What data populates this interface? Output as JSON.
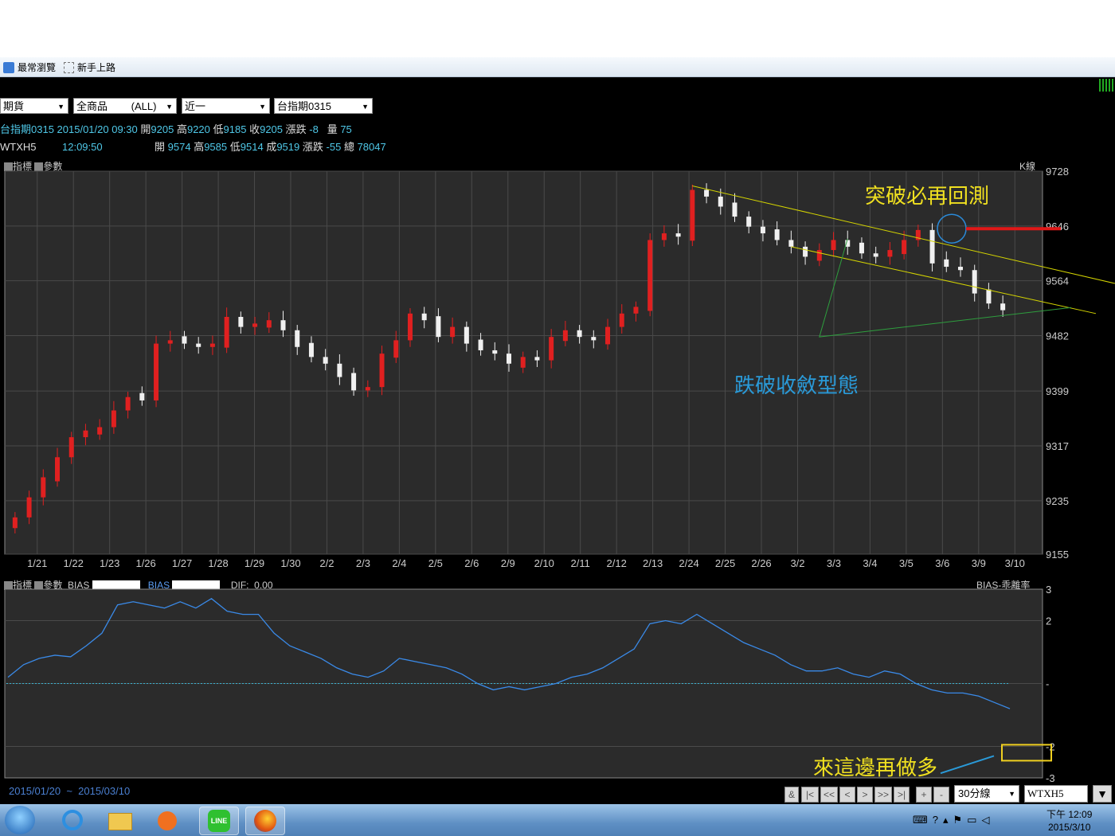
{
  "favorites_bar": {
    "items": [
      {
        "label": "最常瀏覽",
        "icon": "bookmark-icon"
      },
      {
        "label": "新手上路",
        "icon": "page-icon"
      }
    ]
  },
  "toolbar": {
    "market_select": "期貨",
    "product_select": "全商品 　　(ALL)",
    "month_select": "近一",
    "contract_select": "台指期0315"
  },
  "quote_line_1": {
    "name": "台指期0315",
    "datetime": "2015/01/20 09:30",
    "open_label": "開",
    "open": "9205",
    "high_label": "高",
    "high": "9220",
    "low_label": "低",
    "low": "9185",
    "close_label": "收",
    "close": "9205",
    "change_label": "漲跌",
    "change": "-8",
    "volume_label": "量",
    "volume": "75"
  },
  "quote_line_2": {
    "name": "WTXH5",
    "time": "12:09:50",
    "open_label": "開",
    "open": "9574",
    "high_label": "高",
    "high": "9585",
    "low_label": "低",
    "low": "9514",
    "last_label": "成",
    "last": "9519",
    "change_label": "漲跌",
    "change": "-55",
    "total_label": "總",
    "total": "78047"
  },
  "main_panel": {
    "indicator_btn": "指標",
    "param_btn": "參數",
    "chart_type": "K線",
    "annotation_breakout": "突破必再回測",
    "annotation_breakdown": "跌破收斂型態"
  },
  "sub_panel": {
    "indicator_btn": "指標",
    "param_btn": "參數",
    "bias_label_1": "BIAS",
    "bias_label_2": "BIAS",
    "dif_label": "DIF:",
    "dif_value": "0.00",
    "title": "BIAS-乖離率",
    "annotation_buy": "來這邊再做多"
  },
  "footer": {
    "date_from": "2015/01/20",
    "tilde": "~",
    "date_to": "2015/03/10",
    "nav_buttons": [
      "&",
      "|<",
      "<<",
      "<",
      ">",
      ">>",
      ">|",
      "+",
      "-"
    ],
    "interval_select": "30分線",
    "symbol_input": "WTXH5"
  },
  "taskbar": {
    "time": "下午 12:09",
    "date": "2015/3/10",
    "apps": [
      "start-orb-icon",
      "ie-icon",
      "explorer-icon",
      "media-player-icon",
      "line-icon",
      "firefox-icon"
    ]
  },
  "chart_data": [
    {
      "type": "candlestick",
      "title": "K線",
      "y_ticks": [
        9728,
        9646,
        9564,
        9482,
        9399,
        9317,
        9235,
        9155
      ],
      "ylim": [
        9155,
        9728
      ],
      "x_tick_labels": [
        "1/21",
        "1/22",
        "1/23",
        "1/26",
        "1/27",
        "1/28",
        "1/29",
        "1/30",
        "2/2",
        "2/3",
        "2/4",
        "2/5",
        "2/6",
        "2/9",
        "2/10",
        "2/11",
        "2/12",
        "2/13",
        "2/24",
        "2/25",
        "2/26",
        "3/2",
        "3/3",
        "3/4",
        "3/5",
        "3/6",
        "3/9",
        "3/10"
      ],
      "series": [
        {
          "name": "WTXH5 30分線 close (approx.)",
          "values": [
            9210,
            9240,
            9270,
            9300,
            9330,
            9340,
            9345,
            9370,
            9390,
            9385,
            9470,
            9475,
            9470,
            9465,
            9470,
            9510,
            9495,
            9500,
            9505,
            9490,
            9465,
            9450,
            9440,
            9420,
            9400,
            9405,
            9455,
            9475,
            9515,
            9505,
            9480,
            9495,
            9470,
            9460,
            9455,
            9440,
            9450,
            9445,
            9480,
            9490,
            9480,
            9475,
            9495,
            9515,
            9525,
            9625,
            9635,
            9630,
            9700,
            9690,
            9675,
            9660,
            9645,
            9635,
            9625,
            9615,
            9600,
            9610,
            9625,
            9615,
            9605,
            9600,
            9610,
            9625,
            9640,
            9590,
            9585,
            9580,
            9545,
            9530,
            9520
          ]
        }
      ],
      "annotations": [
        "突破必再回測",
        "跌破收斂型態"
      ],
      "horizontal_mark": 9642
    },
    {
      "type": "line",
      "title": "BIAS-乖離率",
      "y_ticks": [
        "3",
        "2",
        "-",
        "-2",
        "-3"
      ],
      "ylim": [
        -3,
        3
      ],
      "zero_line": 0,
      "series": [
        {
          "name": "BIAS",
          "values": [
            0.2,
            0.6,
            0.8,
            0.9,
            0.85,
            1.2,
            1.6,
            2.5,
            2.6,
            2.5,
            2.4,
            2.6,
            2.4,
            2.7,
            2.3,
            2.2,
            2.2,
            1.6,
            1.2,
            1.0,
            0.8,
            0.5,
            0.3,
            0.2,
            0.4,
            0.8,
            0.7,
            0.6,
            0.5,
            0.3,
            0.0,
            -0.2,
            -0.1,
            -0.2,
            -0.1,
            0.0,
            0.2,
            0.3,
            0.5,
            0.8,
            1.1,
            1.9,
            2.0,
            1.9,
            2.2,
            1.9,
            1.6,
            1.3,
            1.1,
            0.9,
            0.6,
            0.4,
            0.4,
            0.5,
            0.3,
            0.2,
            0.4,
            0.3,
            0.0,
            -0.2,
            -0.3,
            -0.3,
            -0.4,
            -0.6,
            -0.8
          ]
        }
      ],
      "annotations": [
        "來這邊再做多"
      ]
    }
  ]
}
